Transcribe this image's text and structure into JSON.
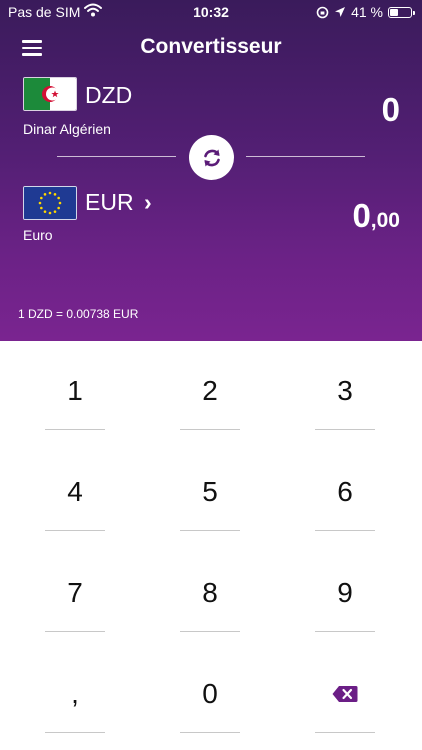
{
  "status_bar": {
    "carrier": "Pas de SIM",
    "time": "10:32",
    "battery": "41 %",
    "battery_level": 0.41
  },
  "header": {
    "title": "Convertisseur"
  },
  "from_currency": {
    "code": "DZD",
    "name": "Dinar Algérien",
    "amount": "0",
    "flag": "algeria-flag"
  },
  "to_currency": {
    "code": "EUR",
    "chevron": "›",
    "name": "Euro",
    "amount_int": "0",
    "amount_dec": ",00",
    "flag": "eu-flag"
  },
  "rate_text": "1 DZD = 0.00738 EUR",
  "keypad": {
    "keys": [
      "1",
      "2",
      "3",
      "4",
      "5",
      "6",
      "7",
      "8",
      "9",
      ",",
      "0"
    ],
    "backspace_icon": "backspace-icon"
  },
  "colors": {
    "header_top": "#3a1b5b",
    "header_bottom": "#7a2490",
    "accent": "#6b1e86"
  }
}
